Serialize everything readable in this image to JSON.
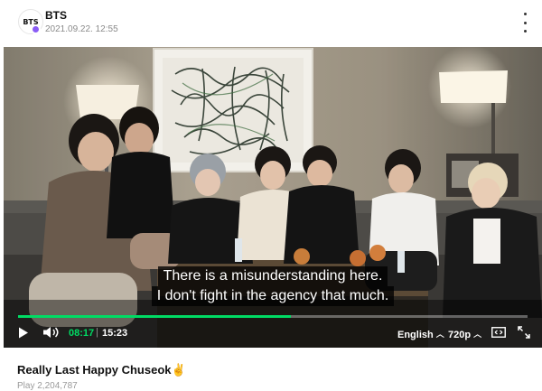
{
  "header": {
    "avatar_text": "BTS",
    "channel_name": "BTS",
    "post_date": "2021.09.22. 12:55",
    "more_icon": "vertical-ellipsis-icon"
  },
  "video": {
    "subtitle_lines": [
      "There is a misunderstanding here.",
      "I don't fight in the agency that much."
    ],
    "progress": 0.535,
    "current_time": "08:17",
    "separator": "|",
    "total_time": "15:23",
    "language": "English",
    "quality": "720p",
    "icons": {
      "play": "play-icon",
      "volume": "volume-icon",
      "captions": "captions-icon",
      "fullscreen": "fullscreen-icon",
      "chevron": "chevron-up-icon"
    },
    "colors": {
      "accent": "#00dc64"
    }
  },
  "post": {
    "title": "Really Last Happy Chuseok✌",
    "meta_partial": "Play 2,204,787"
  }
}
